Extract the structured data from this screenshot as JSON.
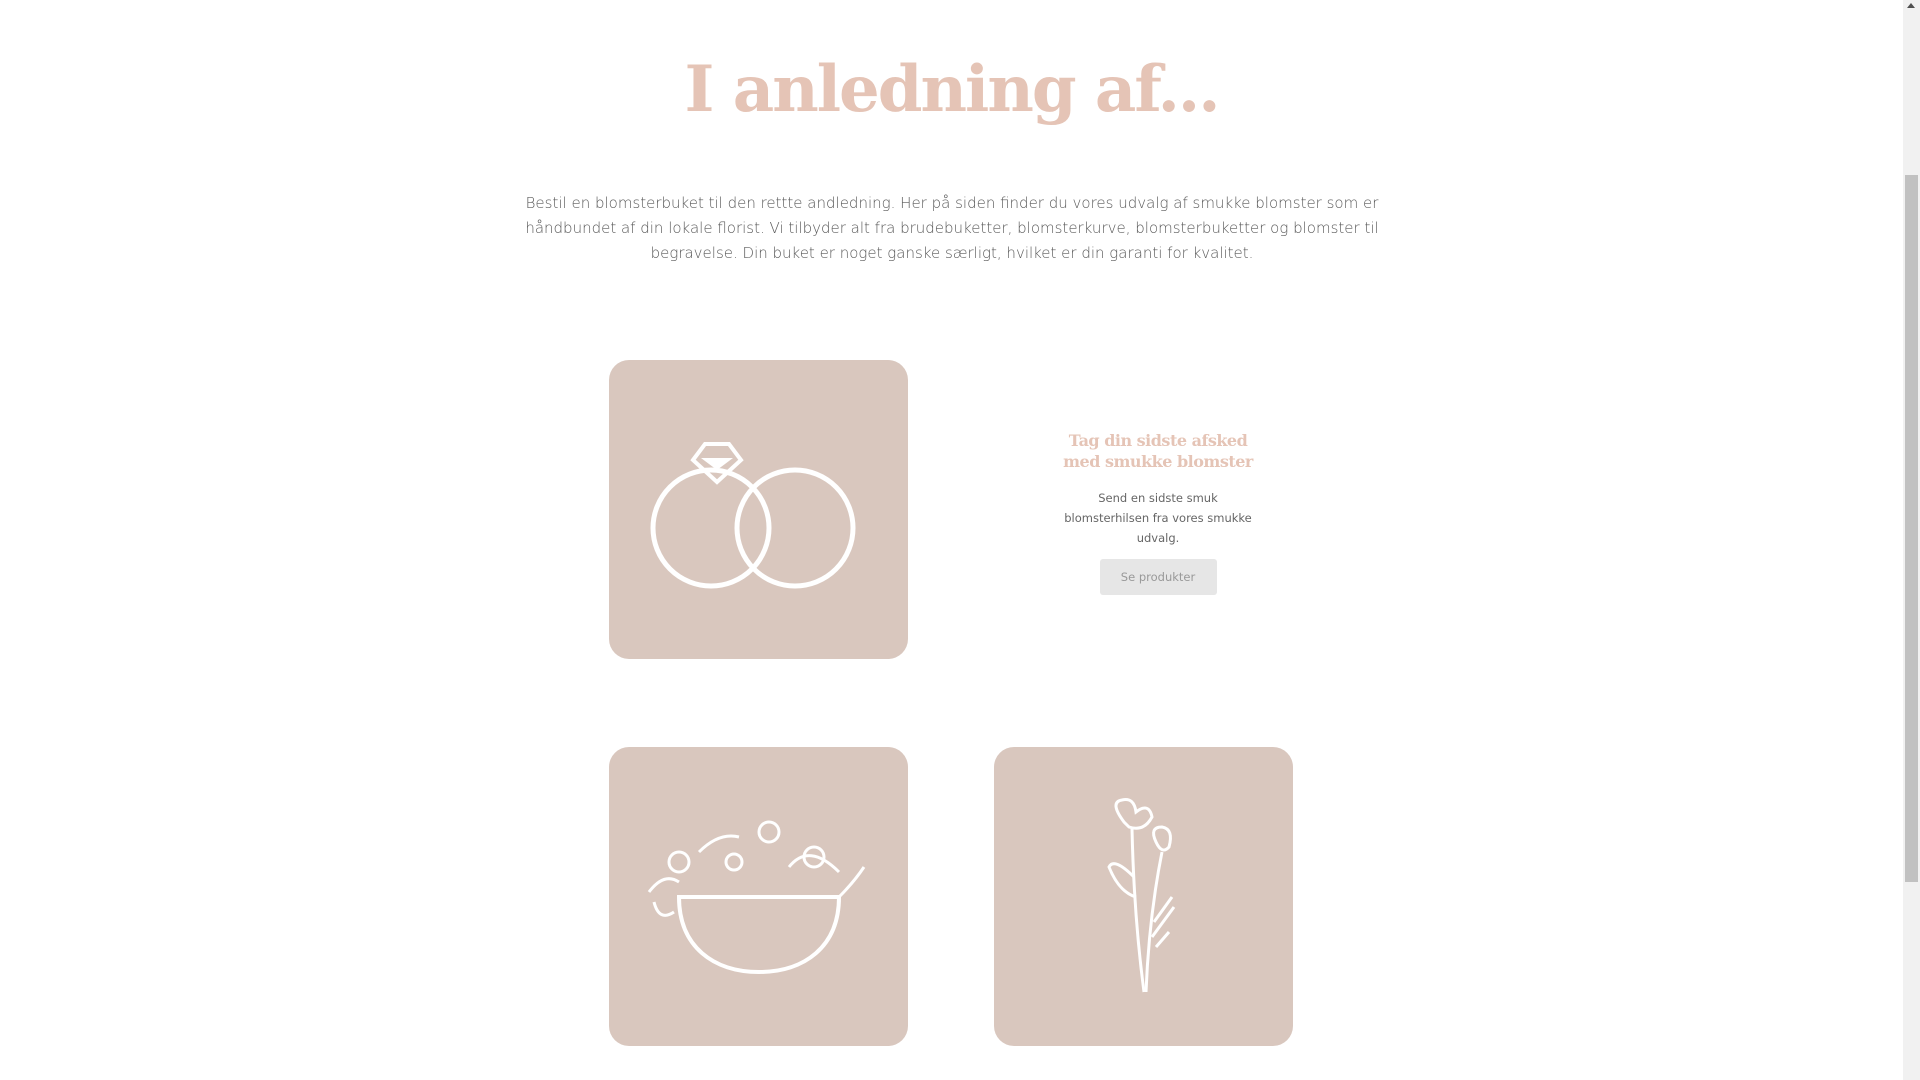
{
  "section": {
    "title": "I anledning af...",
    "intro": "Bestil en blomsterbuket til den rettte andledning. Her på siden finder du vores udvalg af smukke blomster som er håndbundet af din lokale florist. Vi tilbyder alt fra brudebuketter, blomsterkurve, blomsterbuketter og blomster til begravelse. Din buket er noget ganske særligt, hvilket er din garanti for kvalitet."
  },
  "cards": [
    {
      "icon": "wedding-rings-icon"
    },
    {
      "icon": "flower-bowl-icon"
    },
    {
      "icon": "flower-stems-icon"
    }
  ],
  "promo": {
    "heading": "Tag din sidste afsked med smukke blomster",
    "text": "Send en sidste smuk blomsterhilsen fra vores smukke udvalg.",
    "button": "Se produkter"
  },
  "colors": {
    "accent": "#e5c4b6",
    "card": "#d9c7be",
    "button": "#e6e6e6"
  }
}
